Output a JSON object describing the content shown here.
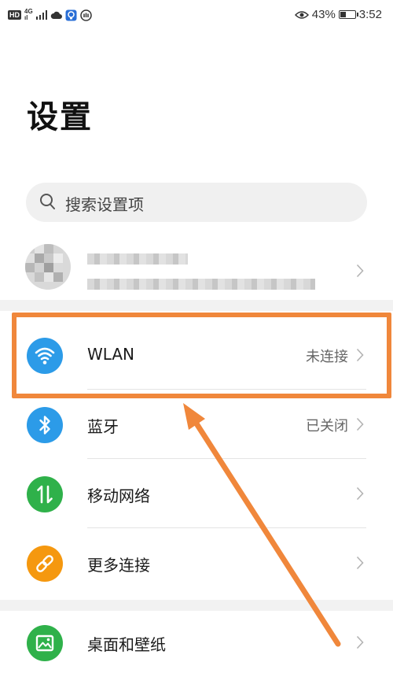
{
  "status_bar": {
    "hd": "HD",
    "network": "4G",
    "signal_sub": "ıl",
    "battery_percent": "43%",
    "battery_level": 0.43,
    "time": "3:52",
    "icons": [
      "signal-icon",
      "cloud-icon",
      "notification-icon",
      "vpn-icon",
      "eye-comfort-icon",
      "battery-icon"
    ]
  },
  "page": {
    "title": "设置"
  },
  "search": {
    "placeholder": "搜索设置项"
  },
  "settings": [
    {
      "id": "wlan",
      "label": "WLAN",
      "status": "未连接",
      "icon": "wifi-icon",
      "color": "#2c9be8"
    },
    {
      "id": "bluetooth",
      "label": "蓝牙",
      "status": "已关闭",
      "icon": "bluetooth-icon",
      "color": "#2c9be8"
    },
    {
      "id": "mobile-network",
      "label": "移动网络",
      "status": "",
      "icon": "mobile-data-icon",
      "color": "#2fb14a"
    },
    {
      "id": "more-connections",
      "label": "更多连接",
      "status": "",
      "icon": "link-icon",
      "color": "#f5980f"
    },
    {
      "id": "home-wallpaper",
      "label": "桌面和壁纸",
      "status": "",
      "icon": "wallpaper-icon",
      "color": "#2fb14a"
    }
  ],
  "annotation": {
    "color": "#f0873b"
  }
}
